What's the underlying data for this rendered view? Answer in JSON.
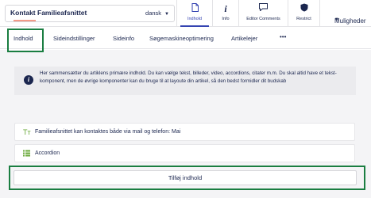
{
  "header": {
    "page_name": "Kontakt Familieafsnittet",
    "language": "dansk",
    "apps": [
      {
        "label": "Indhold",
        "icon": "document-icon"
      },
      {
        "label": "Info",
        "icon": "info-icon"
      },
      {
        "label": "Editor Comments",
        "icon": "comment-icon"
      },
      {
        "label": "Restrict",
        "icon": "shield-icon"
      }
    ],
    "options_label": "Muligheder"
  },
  "tabs": [
    {
      "label": "Indhold",
      "active": true
    },
    {
      "label": "Sideindstillinger",
      "active": false
    },
    {
      "label": "Sideinfo",
      "active": false
    },
    {
      "label": "Søgemaskineoptimering",
      "active": false
    },
    {
      "label": "Artikelejer",
      "active": false
    },
    {
      "label": "•••",
      "active": false
    }
  ],
  "content": {
    "info_text": "Her sammensætter du artiklens primære indhold. Du kan vælge tekst, billeder, video, accordions, citater m.m. Du skal altid have et tekst-komponent, men de øvrige komponenter kan du bruge til at layoute din artikel, så den bedst formidler dit budskab",
    "components": [
      {
        "label": "Familieafsnittet kan kontaktes både via mail og telefon: Mai",
        "icon": "text-component-icon"
      },
      {
        "label": "Accordion",
        "icon": "list-component-icon"
      }
    ],
    "add_button": "Tilføj indhold"
  },
  "colors": {
    "text": "#1b264f",
    "active_app": "#3544b1",
    "tab_indicator": "#f39a88",
    "highlight": "#1a7e41",
    "component_icon": "#6aa93a",
    "background": "#f4f4f6"
  }
}
